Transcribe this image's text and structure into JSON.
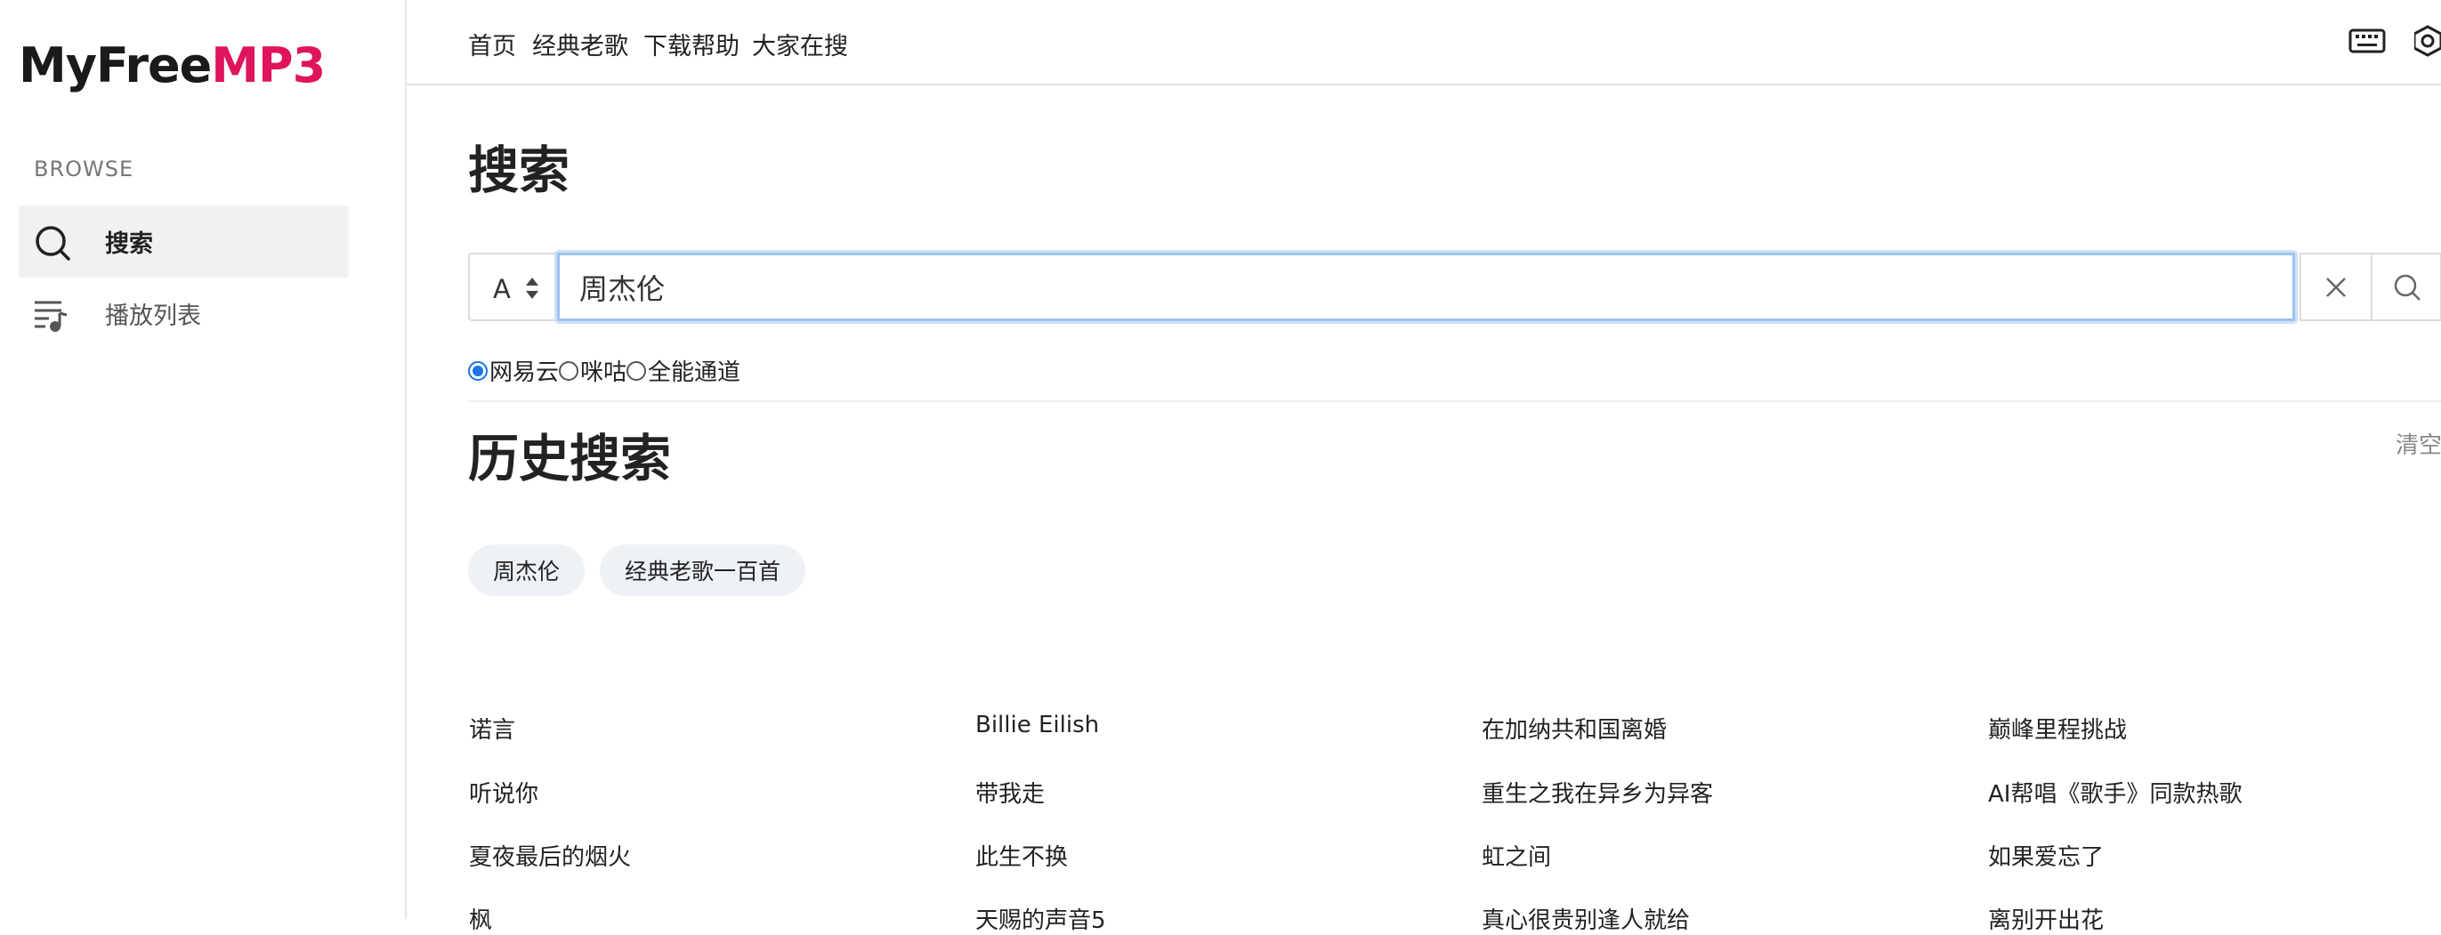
{
  "brand": {
    "part1": "MyFree",
    "part2": "MP3",
    "accent_color": "#e0135d"
  },
  "sidebar": {
    "section_label": "BROWSE",
    "items": [
      {
        "label": "搜索",
        "icon": "search-icon",
        "active": true
      },
      {
        "label": "播放列表",
        "icon": "playlist-icon",
        "active": false
      }
    ]
  },
  "topnav": {
    "links": [
      "首页",
      "经典老歌",
      "下载帮助",
      "大家在搜"
    ],
    "icons": [
      "keyboard-icon",
      "settings-icon"
    ]
  },
  "search": {
    "title": "搜索",
    "select_value": "A",
    "query": "周杰伦",
    "clear_icon": "close-icon",
    "submit_icon": "search-icon",
    "sources": [
      {
        "label": "网易云",
        "checked": true
      },
      {
        "label": "咪咕",
        "checked": false
      },
      {
        "label": "全能通道",
        "checked": false
      }
    ]
  },
  "history": {
    "title": "历史搜索",
    "clear_label": "清空",
    "chips": [
      "周杰伦",
      "经典老歌一百首"
    ]
  },
  "hot_searches": [
    [
      "诺言",
      "Billie Eilish",
      "在加纳共和国离婚",
      "巅峰里程挑战"
    ],
    [
      "听说你",
      "带我走",
      "重生之我在异乡为异客",
      "AI帮唱《歌手》同款热歌"
    ],
    [
      "夏夜最后的烟火",
      "此生不换",
      "虹之间",
      "如果爱忘了"
    ],
    [
      "枫",
      "天赐的声音5",
      "真心很贵别逢人就给",
      "离别开出花"
    ]
  ]
}
